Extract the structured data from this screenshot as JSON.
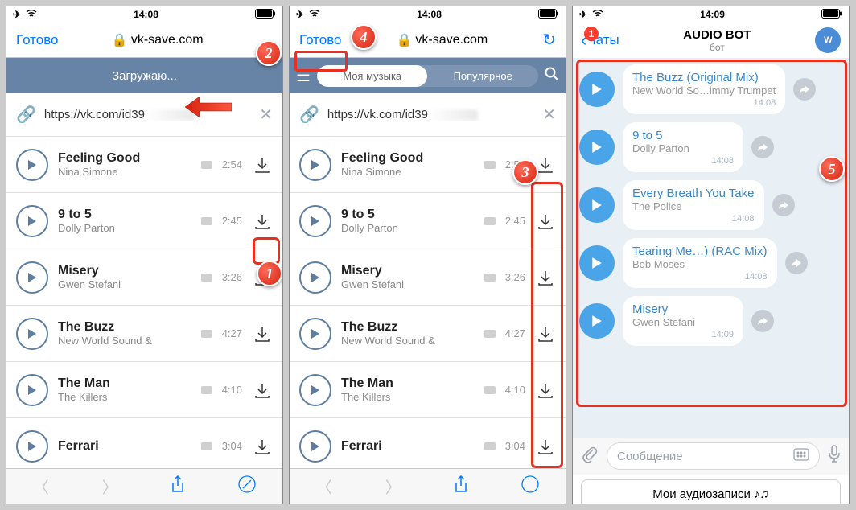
{
  "status": {
    "time": "14:08",
    "time3": "14:09"
  },
  "nav": {
    "done": "Готово",
    "domain": "vk-save.com"
  },
  "panel1": {
    "loading": "Загружаю...",
    "url": "https://vk.com/id39",
    "tracks": [
      {
        "title": "Feeling Good",
        "artist": "Nina Simone",
        "dur": "2:54"
      },
      {
        "title": "9 to 5",
        "artist": "Dolly Parton",
        "dur": "2:45"
      },
      {
        "title": "Misery",
        "artist": "Gwen Stefani",
        "dur": "3:26"
      },
      {
        "title": "The Buzz",
        "artist": "New World Sound &",
        "dur": "4:27"
      },
      {
        "title": "The Man",
        "artist": "The Killers",
        "dur": "4:10"
      },
      {
        "title": "Ferrari",
        "artist": "",
        "dur": "3:04"
      }
    ]
  },
  "panel2": {
    "tabs": {
      "mymusic": "Моя музыка",
      "popular": "Популярное"
    },
    "url": "https://vk.com/id39",
    "tracks": [
      {
        "title": "Feeling Good",
        "artist": "Nina Simone",
        "dur": "2:54"
      },
      {
        "title": "9 to 5",
        "artist": "Dolly Parton",
        "dur": "2:45"
      },
      {
        "title": "Misery",
        "artist": "Gwen Stefani",
        "dur": "3:26"
      },
      {
        "title": "The Buzz",
        "artist": "New World Sound &",
        "dur": "4:27"
      },
      {
        "title": "The Man",
        "artist": "The Killers",
        "dur": "4:10"
      },
      {
        "title": "Ferrari",
        "artist": "",
        "dur": "3:04"
      }
    ]
  },
  "panel3": {
    "back": "Чаты",
    "badge": "1",
    "title": "AUDIO BOT",
    "subtitle": "бот",
    "messages": [
      {
        "title": "The Buzz (Original Mix)",
        "artist": "New World So…immy Trumpet",
        "time": "14:08"
      },
      {
        "title": "9 to 5",
        "artist": "Dolly Parton",
        "time": "14:08"
      },
      {
        "title": "Every Breath You Take",
        "artist": "The Police",
        "time": "14:08"
      },
      {
        "title": "Tearing Me…) (RAC Mix)",
        "artist": "Bob Moses",
        "time": "14:08"
      },
      {
        "title": "Misery",
        "artist": "Gwen Stefani",
        "time": "14:09"
      }
    ],
    "input_placeholder": "Сообщение",
    "my_audio": "Мои аудиозаписи ♪♫"
  },
  "annotations": {
    "a1": "1",
    "a2": "2",
    "a3": "3",
    "a4": "4",
    "a5": "5"
  }
}
